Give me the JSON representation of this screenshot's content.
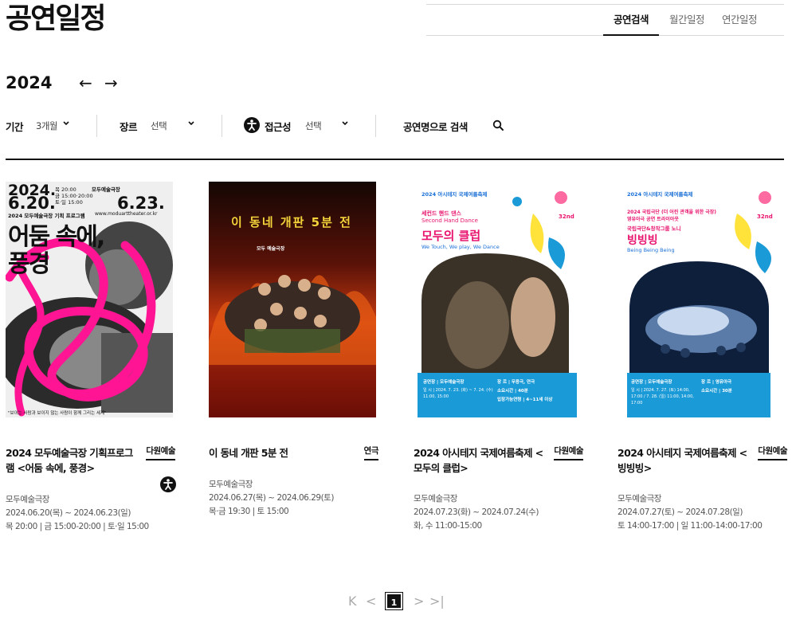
{
  "page": {
    "title": "공연일정"
  },
  "view_tabs": [
    {
      "label": "공연검색",
      "active": true
    },
    {
      "label": "월간일정",
      "active": false
    },
    {
      "label": "연간일정",
      "active": false
    }
  ],
  "year_nav": {
    "year": "2024",
    "prev_icon": "←",
    "next_icon": "→"
  },
  "filters": {
    "period": {
      "label": "기간",
      "value": "3개월"
    },
    "genre": {
      "label": "장르",
      "value": "선택"
    },
    "accessibility": {
      "label": "접근성",
      "value": "선택"
    },
    "search": {
      "label": "공연명으로 검색"
    }
  },
  "performances": [
    {
      "title": "2024 모두예술극장 기획프로그램 <어둠 속에, 풍경>",
      "genre": "다원예술",
      "venue": "모두예술극장",
      "dates": "2024.06.20(목) ~ 2024.06.23(일)",
      "times": "목 20:00 | 금 15:00-20:00 | 토·일 15:00",
      "accessible": true,
      "poster": {
        "date_line": "2024.",
        "start": "6.20.",
        "end": "6.23.",
        "small1": "목 20:00",
        "small2": "금 15:00·20:00",
        "small3": "토·일 15:00",
        "venue_tag": "모두예술극장",
        "program": "2024 모두예술극장 기획 프로그램",
        "site": "www.moduarttheater.or.kr",
        "headline1": "어둠 속에,",
        "headline2": "풍경",
        "caption": "\"보이는 사람과 보이지 않는 사람이 함께 그리는 세계\""
      }
    },
    {
      "title": "이 동네 개판 5분 전",
      "genre": "연극",
      "venue": "모두예술극장",
      "dates": "2024.06.27(목) ~ 2024.06.29(토)",
      "times": "목·금 19:30 | 토 15:00",
      "accessible": false,
      "poster": {
        "headline": "이 동네 개판 5분 전",
        "venue_tag": "모두 예술극장"
      }
    },
    {
      "title": "2024 아시테지 국제여름축제 < 모두의 클럽>",
      "genre": "다원예술",
      "venue": "모두예술극장",
      "dates": "2024.07.23(화) ~ 2024.07.24(수)",
      "times": "화, 수 11:00-15:00",
      "accessible": false,
      "poster": {
        "festival": "2024 아시테지 국제여름축제",
        "sub1": "세컨드 핸드 댄스",
        "sub2": "Second Hand Dance",
        "headline": "모두의 클럽",
        "eng": "We Touch, We play, We Dance",
        "badge": "32nd",
        "info1": "공연장 | 모두예술극장",
        "info2": "일 시 | 2024. 7. 23. (화) ~ 7. 24. (수) 11:00, 15:00",
        "info3": "장 르 | 무용극, 연극",
        "info4": "소요시간 | 40분",
        "info5": "입장가능연령 | 4~11세 이상"
      }
    },
    {
      "title": "2024 아시테지 국제여름축제 < 빙빙빙>",
      "genre": "다원예술",
      "venue": "모두예술극장",
      "dates": "2024.07.27(토) ~ 2024.07.28(일)",
      "times": "토 14:00-17:00 | 일 11:00-14:00-17:00",
      "accessible": false,
      "poster": {
        "festival": "2024 아시테지 국제여름축제",
        "sub1": "2024 국립극단 (더 어린 관객을 위한 극장)",
        "sub2": "영유아극 공연 트라이아웃",
        "sub3": "국립극단&창작그룹 노니",
        "headline": "빙빙빙",
        "eng": "Being Being Being",
        "badge": "32nd",
        "info1": "공연장 | 모두예술극장",
        "info2": "일 시 | 2024. 7. 27. (토) 14:00, 17:00 / 7. 28. (일) 11:00, 14:00, 17:00",
        "info3": "장 르 | 영유아극",
        "info4": "소요시간 | 30분"
      }
    }
  ],
  "pagination": {
    "first": "K",
    "prev": "<",
    "current": "1",
    "next": ">",
    "last": ">|"
  },
  "colors": {
    "accent": "#111111",
    "pink": "#ff1493",
    "poster_blue": "#1a9ad6",
    "poster_red": "#b3261e"
  }
}
